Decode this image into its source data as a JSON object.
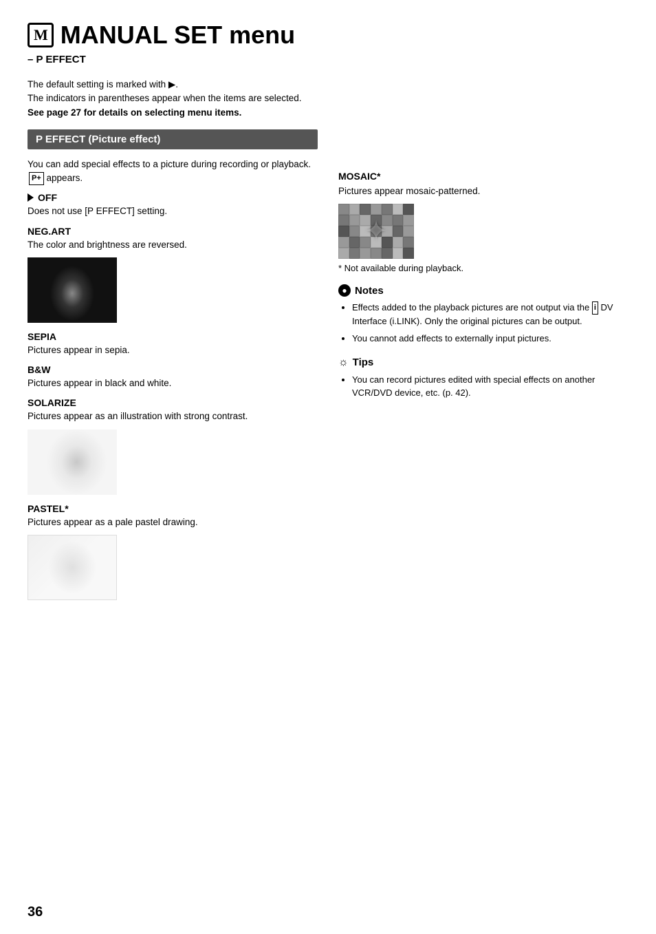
{
  "page": {
    "number": "36",
    "title": "MANUAL SET menu",
    "title_icon": "M",
    "subtitle": "– P EFFECT"
  },
  "intro": {
    "line1": "The default setting is marked with ▶.",
    "line2": "The indicators in parentheses appear when the items are selected.",
    "line3_bold": "See page 27 for details on selecting menu items."
  },
  "section": {
    "header": "P EFFECT (Picture effect)",
    "intro": "You can add special effects to a picture during recording or playback.",
    "badge": "P+",
    "intro_end": "appears."
  },
  "effects": [
    {
      "name": "OFF",
      "has_arrow": true,
      "desc": "Does not use [P EFFECT] setting.",
      "has_image": false
    },
    {
      "name": "NEG.ART",
      "has_arrow": false,
      "desc": "The color and brightness are reversed.",
      "has_image": true,
      "image_type": "neg-art"
    },
    {
      "name": "SEPIA",
      "has_arrow": false,
      "desc": "Pictures appear in sepia.",
      "has_image": false
    },
    {
      "name": "B&W",
      "has_arrow": false,
      "desc": "Pictures appear in black and white.",
      "has_image": false
    },
    {
      "name": "SOLARIZE",
      "has_arrow": false,
      "desc": "Pictures appear as an illustration with strong contrast.",
      "has_image": true,
      "image_type": "solarize"
    },
    {
      "name": "PASTEL*",
      "has_arrow": false,
      "desc": "Pictures appear as a pale pastel drawing.",
      "has_image": true,
      "image_type": "pastel"
    }
  ],
  "right_col": {
    "mosaic_name": "MOSAIC*",
    "mosaic_desc": "Pictures appear mosaic-patterned.",
    "mosaic_note": "*  Not available during playback.",
    "notes_header": "Notes",
    "notes": [
      "Effects added to the playback pictures are not output via the DV Interface (i.LINK). Only the original pictures can be output.",
      "You cannot add effects to externally input pictures."
    ],
    "tips_header": "Tips",
    "tips": [
      "You can record pictures edited with special effects on another VCR/DVD device, etc. (p. 42)."
    ]
  },
  "mosaic_colors": [
    "#888",
    "#aaa",
    "#666",
    "#999",
    "#777",
    "#bbb",
    "#555",
    "#777",
    "#999",
    "#aaa",
    "#666",
    "#888",
    "#777",
    "#999",
    "#555",
    "#888",
    "#bbb",
    "#777",
    "#aaa",
    "#666",
    "#999",
    "#999",
    "#666",
    "#888",
    "#bbb",
    "#555",
    "#aaa",
    "#777",
    "#aaa",
    "#777",
    "#999",
    "#888",
    "#666",
    "#bbb",
    "#555"
  ]
}
